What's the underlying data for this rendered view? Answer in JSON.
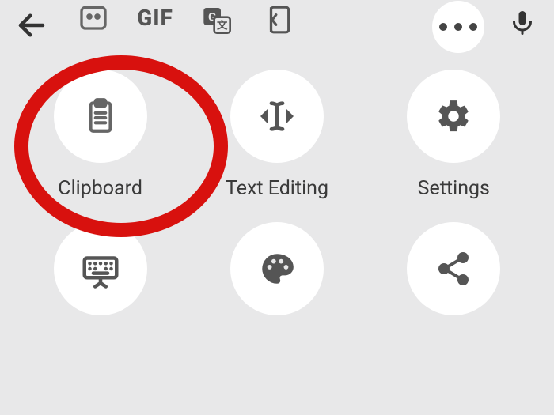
{
  "toolbar": {
    "back": "back",
    "sticker": "sticker",
    "gif_label": "GIF",
    "translate": "translate",
    "onehand": "one-handed",
    "more": "more",
    "mic": "mic"
  },
  "tiles": {
    "clipboard": {
      "label": "Clipboard"
    },
    "text_editing": {
      "label": "Text Editing"
    },
    "settings": {
      "label": "Settings"
    },
    "keyboard": {
      "label": ""
    },
    "theme": {
      "label": ""
    },
    "share": {
      "label": ""
    }
  },
  "highlight_target": "clipboard"
}
